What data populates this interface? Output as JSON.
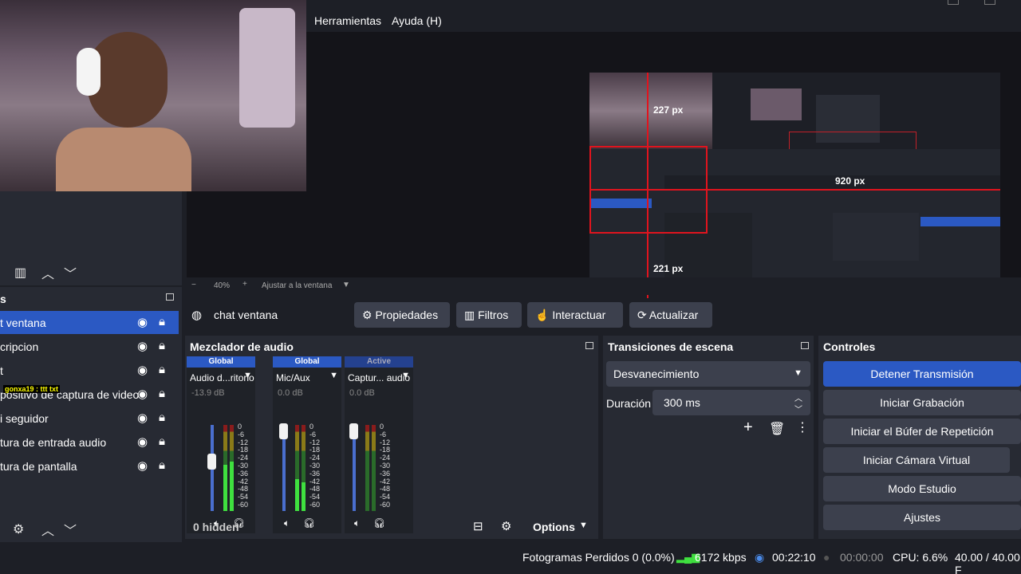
{
  "menubar": {
    "tools": "Herramientas",
    "help": "Ayuda (H)"
  },
  "zoom": {
    "minus": "−",
    "level": "40%",
    "plus": "+",
    "fit": "Ajustar a la ventana"
  },
  "preview_overlay": {
    "dim_top": "227 px",
    "dim_right": "920 px",
    "dim_bottom": "221 px"
  },
  "sources": {
    "title": "s",
    "items": [
      {
        "label": "t ventana",
        "active": true
      },
      {
        "label": "cripcion"
      },
      {
        "label": "t"
      },
      {
        "label": "positivo de captura de video"
      },
      {
        "label": "i seguidor"
      },
      {
        "label": "tura de entrada audio"
      },
      {
        "label": "tura de pantalla"
      }
    ],
    "chat_overlay": "gonxa19 : ttt txt"
  },
  "props_bar": {
    "source_name": "chat ventana",
    "properties": "Propiedades",
    "filters": "Filtros",
    "interact": "Interactuar",
    "refresh": "Actualizar"
  },
  "mixer": {
    "title": "Mezclador de audio",
    "channels": [
      {
        "badge": "Global",
        "name": "Audio d...ritorio",
        "db": "-13.9 dB",
        "level": 0.55
      },
      {
        "badge": "Global",
        "name": "Mic/Aux",
        "db": "0.0 dB",
        "level": 0.35
      },
      {
        "badge": "Active",
        "name": "Captur... audio",
        "db": "0.0 dB",
        "level": 0.0
      }
    ],
    "scale": [
      "0",
      "-6",
      "-12",
      "-18",
      "-24",
      "-30",
      "-36",
      "-42",
      "-48",
      "-54",
      "-60"
    ],
    "hidden": "0 hidden",
    "options": "Options"
  },
  "transitions": {
    "title": "Transiciones de escena",
    "selected": "Desvanecimiento",
    "duration_label": "Duración",
    "duration_value": "300 ms"
  },
  "controls": {
    "title": "Controles",
    "buttons": [
      "Detener Transmisión",
      "Iniciar Grabación",
      "Iniciar el Búfer de Repetición",
      "Iniciar Cámara Virtual",
      "Modo Estudio",
      "Ajustes"
    ]
  },
  "status": {
    "dropped": "Fotogramas Perdidos 0 (0.0%)",
    "bitrate": "6172 kbps",
    "stream_time": "00:22:10",
    "rec_time": "00:00:00",
    "cpu": "CPU: 6.6%",
    "fps": "40.00 / 40.00 F"
  },
  "colors": {
    "accent": "#2b59c3",
    "panel": "#272a33",
    "bg": "#1d1f26",
    "button": "#3c404d",
    "red_guide": "#e0141e"
  }
}
